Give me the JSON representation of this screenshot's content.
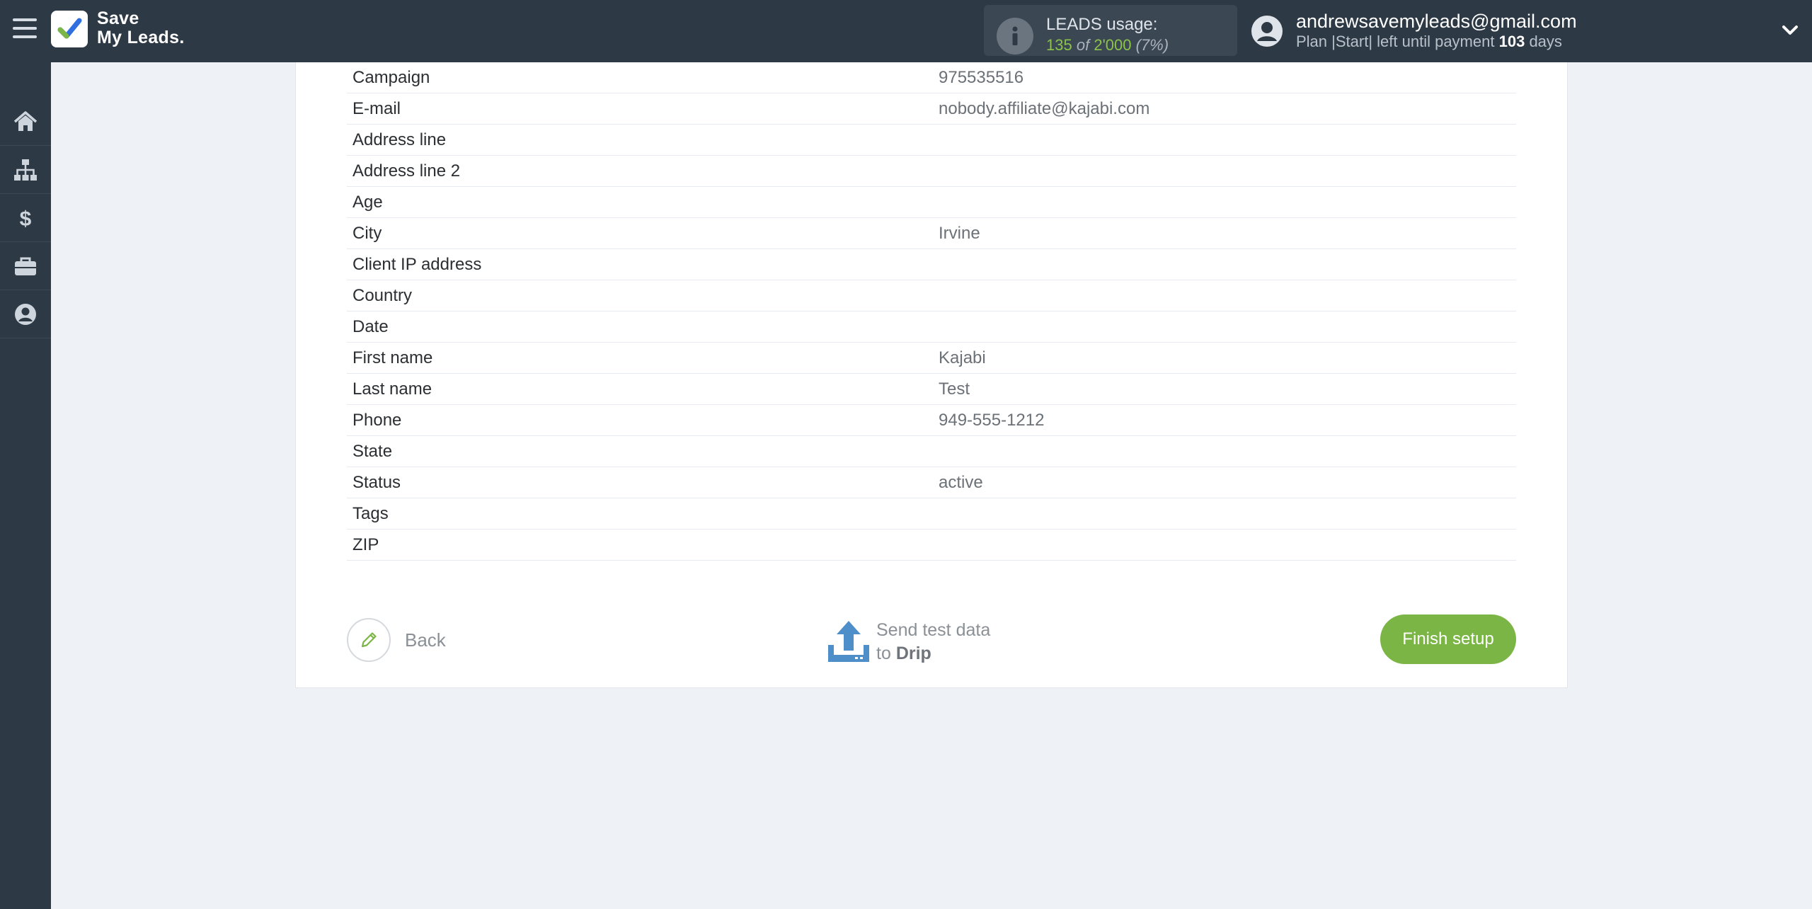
{
  "brand": {
    "line1": "Save",
    "line2": "My Leads."
  },
  "usage": {
    "label": "LEADS usage:",
    "used": "135",
    "of": "of",
    "total": "2'000",
    "percent": "(7%)"
  },
  "account": {
    "email": "andrewsavemyleads@gmail.com",
    "plan_prefix": "Plan |Start| left until payment",
    "days_count": "103",
    "days_suffix": "days"
  },
  "sidebar": {
    "items": [
      {
        "icon": "home-icon"
      },
      {
        "icon": "sitemap-icon"
      },
      {
        "icon": "dollar-icon"
      },
      {
        "icon": "briefcase-icon"
      },
      {
        "icon": "user-circle-icon"
      }
    ]
  },
  "fields": [
    {
      "key": "Campaign",
      "value": "975535516"
    },
    {
      "key": "E-mail",
      "value": "nobody.affiliate@kajabi.com"
    },
    {
      "key": "Address line",
      "value": ""
    },
    {
      "key": "Address line 2",
      "value": ""
    },
    {
      "key": "Age",
      "value": ""
    },
    {
      "key": "City",
      "value": "Irvine"
    },
    {
      "key": "Client IP address",
      "value": ""
    },
    {
      "key": "Country",
      "value": ""
    },
    {
      "key": "Date",
      "value": ""
    },
    {
      "key": "First name",
      "value": "Kajabi"
    },
    {
      "key": "Last name",
      "value": "Test"
    },
    {
      "key": "Phone",
      "value": "949-555-1212"
    },
    {
      "key": "State",
      "value": ""
    },
    {
      "key": "Status",
      "value": "active"
    },
    {
      "key": "Tags",
      "value": ""
    },
    {
      "key": "ZIP",
      "value": ""
    }
  ],
  "actions": {
    "back_label": "Back",
    "send_line1": "Send test data",
    "send_to": "to",
    "send_target": "Drip",
    "finish_label": "Finish setup"
  },
  "colors": {
    "topbar": "#2d3945",
    "accent_green": "#7bb545",
    "upload_blue": "#4f8fc9"
  }
}
